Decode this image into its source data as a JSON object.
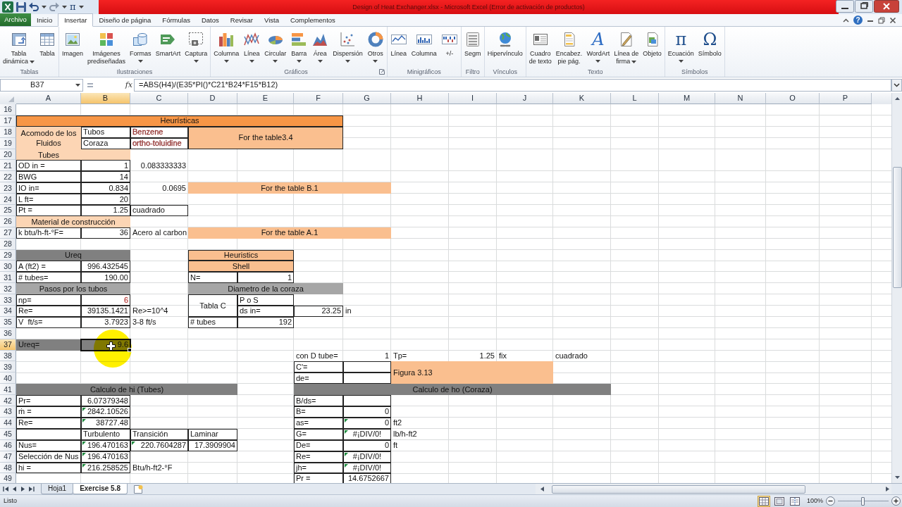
{
  "title_bar": {
    "quick_glyph": "π",
    "title": "Design of Heat Exchanger.xlsx - Microsoft Excel (Error de activación de productos)"
  },
  "ribbon_tabs": [
    {
      "label": "Archivo",
      "kind": "file",
      "selected": false
    },
    {
      "label": "Inicio",
      "kind": "tab",
      "selected": false
    },
    {
      "label": "Insertar",
      "kind": "tab",
      "selected": true
    },
    {
      "label": "Diseño de página",
      "kind": "tab",
      "selected": false
    },
    {
      "label": "Fórmulas",
      "kind": "tab",
      "selected": false
    },
    {
      "label": "Datos",
      "kind": "tab",
      "selected": false
    },
    {
      "label": "Revisar",
      "kind": "tab",
      "selected": false
    },
    {
      "label": "Vista",
      "kind": "tab",
      "selected": false
    },
    {
      "label": "Complementos",
      "kind": "tab",
      "selected": false
    }
  ],
  "help_glyph": "?",
  "ribbon_groups": [
    {
      "title": "Tablas",
      "launcher": false,
      "items": [
        {
          "label": "Tabla\ndinámica",
          "dropdown": true
        },
        {
          "label": "Tabla",
          "dropdown": false
        }
      ]
    },
    {
      "title": "Ilustraciones",
      "launcher": false,
      "items": [
        {
          "label": "Imagen",
          "dropdown": false
        },
        {
          "label": "Imágenes\nprediseñadas",
          "dropdown": false
        },
        {
          "label": "Formas",
          "dropdown": true
        },
        {
          "label": "SmartArt",
          "dropdown": false
        },
        {
          "label": "Captura",
          "dropdown": true
        }
      ]
    },
    {
      "title": "Gráficos",
      "launcher": true,
      "items": [
        {
          "label": "Columna",
          "dropdown": true
        },
        {
          "label": "Línea",
          "dropdown": true
        },
        {
          "label": "Circular",
          "dropdown": true
        },
        {
          "label": "Barra",
          "dropdown": true
        },
        {
          "label": "Área",
          "dropdown": true
        },
        {
          "label": "Dispersión",
          "dropdown": true
        },
        {
          "label": "Otros",
          "dropdown": true
        }
      ]
    },
    {
      "title": "Minigráficos",
      "launcher": false,
      "items": [
        {
          "label": "Línea",
          "dropdown": false
        },
        {
          "label": "Columna",
          "dropdown": false
        },
        {
          "label": "+/-",
          "dropdown": false
        }
      ]
    },
    {
      "title": "Filtro",
      "launcher": false,
      "items": [
        {
          "label": "Segm",
          "dropdown": false
        }
      ]
    },
    {
      "title": "Vínculos",
      "launcher": false,
      "items": [
        {
          "label": "Hipervínculo",
          "dropdown": false
        }
      ]
    },
    {
      "title": "Texto",
      "launcher": false,
      "items": [
        {
          "label": "Cuadro\nde texto",
          "dropdown": false
        },
        {
          "label": "Encabez.\npie pág.",
          "dropdown": false
        },
        {
          "label": "WordArt",
          "glyph": "A",
          "dropdown": true
        },
        {
          "label": "Línea de\nfirma",
          "dropdown": true
        },
        {
          "label": "Objeto",
          "dropdown": false
        }
      ]
    },
    {
      "title": "Símbolos",
      "launcher": false,
      "items": [
        {
          "label": "Ecuación",
          "glyph": "π",
          "dropdown": true
        },
        {
          "label": "Símbolo",
          "glyph": "Ω",
          "dropdown": false
        }
      ]
    }
  ],
  "formula_bar": {
    "name_box": "B37",
    "function_label": "fx",
    "formula": "=ABS(H4)/(E35*PI()*C21*B24*F15*B12)"
  },
  "sheet": {
    "columns": [
      {
        "label": "A",
        "selected": false
      },
      {
        "label": "B",
        "selected": true
      },
      {
        "label": "C",
        "selected": false
      },
      {
        "label": "D",
        "selected": false
      },
      {
        "label": "E",
        "selected": false
      },
      {
        "label": "F",
        "selected": false
      },
      {
        "label": "G",
        "selected": false
      },
      {
        "label": "H",
        "selected": false
      },
      {
        "label": "I",
        "selected": false
      },
      {
        "label": "J",
        "selected": false
      },
      {
        "label": "K",
        "selected": false
      },
      {
        "label": "L",
        "selected": false
      },
      {
        "label": "M",
        "selected": false
      },
      {
        "label": "N",
        "selected": false
      },
      {
        "label": "O",
        "selected": false
      },
      {
        "label": "P",
        "selected": false
      }
    ],
    "rows": [
      {
        "label": "16",
        "selected": false
      },
      {
        "label": "17",
        "selected": false,
        "cells": [
          {
            "text": "Heurísticas",
            "kind": "title",
            "boxed": true,
            "flagged": false,
            "selected": false
          }
        ]
      },
      {
        "label": "18",
        "selected": false,
        "cells": [
          {
            "text": "Acomodo de los Fluidos",
            "kind": "tint",
            "boxed": false,
            "flagged": false,
            "selected": false
          },
          {
            "text": "Tubos",
            "kind": "text",
            "boxed": true,
            "flagged": false,
            "selected": false
          },
          {
            "text": "Benzene",
            "kind": "text",
            "color": "#953735",
            "boxed": true,
            "flagged": false,
            "selected": false
          },
          {
            "text": "For the table3.4",
            "kind": "band",
            "boxed": true,
            "flagged": false,
            "selected": false
          }
        ]
      },
      {
        "label": "19",
        "selected": false,
        "cells": [
          null,
          {
            "text": "Coraza",
            "kind": "text",
            "boxed": true,
            "flagged": false,
            "selected": false
          },
          {
            "text": "ortho-toluidine",
            "kind": "text",
            "color": "#953735",
            "boxed": true,
            "flagged": false,
            "selected": false
          }
        ]
      },
      {
        "label": "20",
        "selected": false,
        "cells": [
          {
            "text": "Tubes",
            "kind": "tint",
            "boxed": false,
            "flagged": false,
            "selected": false
          },
          {
            "kind": "tint",
            "boxed": false,
            "flagged": false,
            "selected": false
          }
        ]
      },
      {
        "label": "21",
        "selected": false,
        "cells": [
          {
            "text": "OD in =",
            "kind": "text",
            "boxed": true,
            "flagged": false,
            "selected": false
          },
          {
            "text": "1",
            "kind": "number",
            "boxed": true,
            "flagged": false,
            "selected": false
          },
          {
            "text": "0.083333333",
            "kind": "number",
            "boxed": false,
            "flagged": false,
            "selected": false
          }
        ]
      },
      {
        "label": "22",
        "selected": false,
        "cells": [
          {
            "text": "BWG",
            "kind": "text",
            "boxed": true,
            "flagged": false,
            "selected": false
          },
          {
            "text": "14",
            "kind": "number",
            "boxed": true,
            "flagged": false,
            "selected": false
          }
        ]
      },
      {
        "label": "23",
        "selected": false,
        "cells": [
          {
            "text": "IO in=",
            "kind": "text",
            "boxed": true,
            "flagged": false,
            "selected": false
          },
          {
            "text": "0.834",
            "kind": "number",
            "boxed": true,
            "flagged": false,
            "selected": false
          },
          {
            "text": "0.0695",
            "kind": "number",
            "boxed": false,
            "flagged": false,
            "selected": false
          },
          {
            "text": "For the table B.1",
            "kind": "band",
            "boxed": false,
            "flagged": false,
            "selected": false
          }
        ]
      },
      {
        "label": "24",
        "selected": false,
        "cells": [
          {
            "text": "L ft=",
            "kind": "text",
            "boxed": true,
            "flagged": false,
            "selected": false
          },
          {
            "text": "20",
            "kind": "number",
            "boxed": true,
            "flagged": false,
            "selected": false
          }
        ]
      },
      {
        "label": "25",
        "selected": false,
        "cells": [
          {
            "text": "Pt =",
            "kind": "text",
            "boxed": true,
            "flagged": false,
            "selected": false
          },
          {
            "text": "1.25",
            "kind": "number",
            "boxed": true,
            "flagged": false,
            "selected": false
          },
          {
            "text": "cuadrado",
            "kind": "text",
            "boxed": true,
            "flagged": false,
            "selected": false
          }
        ]
      },
      {
        "label": "26",
        "selected": false,
        "cells": [
          {
            "text": "Material de construcción",
            "kind": "tint",
            "boxed": false,
            "flagged": false,
            "selected": false
          }
        ]
      },
      {
        "label": "27",
        "selected": false,
        "cells": [
          {
            "text": "k btu/h-ft-°F=",
            "kind": "text",
            "boxed": true,
            "flagged": false,
            "selected": false
          },
          {
            "text": "36",
            "kind": "number",
            "boxed": true,
            "flagged": false,
            "selected": false
          },
          {
            "text": "Acero al carbon",
            "kind": "text",
            "boxed": false,
            "flagged": false,
            "selected": false
          },
          {
            "text": "For the table A.1",
            "kind": "band",
            "boxed": false,
            "flagged": false,
            "selected": false
          }
        ]
      },
      {
        "label": "28",
        "selected": false
      },
      {
        "label": "29",
        "selected": false,
        "cells": [
          {
            "text": "Ureq",
            "kind": "section",
            "boxed": false,
            "flagged": false,
            "selected": false
          },
          null,
          null,
          {
            "text": "Heuristics",
            "kind": "band",
            "boxed": true,
            "flagged": false,
            "selected": false
          }
        ]
      },
      {
        "label": "30",
        "selected": false,
        "cells": [
          {
            "text": "A (ft2) =",
            "kind": "text",
            "boxed": true,
            "flagged": false,
            "selected": false
          },
          {
            "text": "996.432545",
            "kind": "number",
            "boxed": true,
            "flagged": false,
            "selected": false
          },
          null,
          {
            "text": "Shell",
            "kind": "band",
            "boxed": true,
            "flagged": false,
            "selected": false
          }
        ]
      },
      {
        "label": "31",
        "selected": false,
        "cells": [
          {
            "text": "# tubes=",
            "kind": "text",
            "boxed": true,
            "flagged": false,
            "selected": false
          },
          {
            "text": "190.00",
            "kind": "number",
            "boxed": true,
            "flagged": false,
            "selected": false
          },
          null,
          {
            "text": "N=",
            "kind": "text",
            "boxed": true,
            "flagged": false,
            "selected": false
          },
          {
            "text": "1",
            "kind": "number",
            "boxed": true,
            "flagged": false,
            "selected": false
          }
        ]
      },
      {
        "label": "32",
        "selected": false,
        "cells": [
          {
            "text": "Pasos por los tubos",
            "kind": "subsection",
            "boxed": false,
            "flagged": false,
            "selected": false
          },
          null,
          null,
          {
            "text": "Diametro de la coraza",
            "kind": "subsection",
            "boxed": false,
            "flagged": false,
            "selected": false
          }
        ]
      },
      {
        "label": "33",
        "selected": false,
        "cells": [
          {
            "text": "np=",
            "kind": "text",
            "boxed": true,
            "flagged": false,
            "selected": false
          },
          {
            "text": "6",
            "kind": "number",
            "color": "#c0504d",
            "boxed": true,
            "flagged": false,
            "selected": false
          },
          null,
          {
            "text": "Tabla C",
            "kind": "center",
            "boxed": true,
            "flagged": false,
            "selected": false
          },
          {
            "text": "P o S",
            "kind": "text",
            "boxed": true,
            "flagged": false,
            "selected": false
          }
        ]
      },
      {
        "label": "34",
        "selected": false,
        "cells": [
          {
            "text": "Re=",
            "kind": "text",
            "boxed": true,
            "flagged": false,
            "selected": false
          },
          {
            "text": "39135.1421",
            "kind": "number",
            "boxed": true,
            "flagged": false,
            "selected": false
          },
          {
            "text": "Re>=10^4",
            "kind": "text",
            "boxed": false,
            "flagged": false,
            "selected": false
          },
          null,
          {
            "text": "ds in=",
            "kind": "text",
            "boxed": true,
            "flagged": false,
            "selected": false
          },
          {
            "text": "23.25",
            "kind": "number",
            "boxed": true,
            "flagged": false,
            "selected": false
          },
          {
            "text": "in",
            "kind": "text",
            "boxed": false,
            "flagged": false,
            "selected": false
          }
        ]
      },
      {
        "label": "35",
        "selected": false,
        "cells": [
          {
            "text": "V  ft/s=",
            "kind": "text",
            "boxed": true,
            "flagged": false,
            "selected": false
          },
          {
            "text": "3.7923",
            "kind": "number",
            "boxed": true,
            "flagged": false,
            "selected": false
          },
          {
            "text": "3-8 ft/s",
            "kind": "text",
            "boxed": false,
            "flagged": false,
            "selected": false
          },
          {
            "text": "# tubes",
            "kind": "text",
            "boxed": true,
            "flagged": false,
            "selected": false
          },
          {
            "text": "192",
            "kind": "number",
            "boxed": true,
            "flagged": false,
            "selected": false
          }
        ]
      },
      {
        "label": "36",
        "selected": false
      },
      {
        "label": "37",
        "selected": true,
        "cells": [
          {
            "text": "Ureq=",
            "kind": "section-text",
            "boxed": false,
            "flagged": false,
            "selected": false
          },
          {
            "text": "9.6",
            "kind": "section-number",
            "boxed": false,
            "flagged": false,
            "selected": true
          }
        ]
      },
      {
        "label": "38",
        "selected": false,
        "cells": [
          null,
          null,
          null,
          null,
          null,
          {
            "text": "con D tube=",
            "kind": "text",
            "boxed": false,
            "flagged": false,
            "selected": false
          },
          {
            "text": "1",
            "kind": "number",
            "boxed": false,
            "flagged": false,
            "selected": false
          },
          {
            "text": "Tp=",
            "kind": "text",
            "boxed": false,
            "flagged": false,
            "selected": false
          },
          {
            "text": "1.25",
            "kind": "number",
            "boxed": false,
            "flagged": false,
            "selected": false
          },
          {
            "text": "fix",
            "kind": "text",
            "boxed": false,
            "flagged": false,
            "selected": false
          },
          {
            "text": "cuadrado",
            "kind": "text",
            "boxed": false,
            "flagged": false,
            "selected": false
          }
        ]
      },
      {
        "label": "39",
        "selected": false,
        "cells": [
          null,
          null,
          null,
          null,
          null,
          {
            "text": "C'=",
            "kind": "text",
            "boxed": true,
            "flagged": false,
            "selected": false
          },
          {
            "kind": "text",
            "boxed": true,
            "flagged": false,
            "selected": false
          },
          {
            "text": "Figura 3.13",
            "kind": "band-left",
            "boxed": false,
            "flagged": false,
            "selected": false
          }
        ]
      },
      {
        "label": "40",
        "selected": false,
        "cells": [
          null,
          null,
          null,
          null,
          null,
          {
            "text": "de=",
            "kind": "text",
            "boxed": true,
            "flagged": false,
            "selected": false
          },
          {
            "kind": "text",
            "boxed": true,
            "flagged": false,
            "selected": false
          }
        ]
      },
      {
        "label": "41",
        "selected": false,
        "cells": [
          {
            "text": "Calculo de hi (Tubes)",
            "kind": "section",
            "boxed": false,
            "flagged": false,
            "selected": false
          },
          null,
          null,
          null,
          null,
          {
            "text": "Calculo de ho (Coraza)",
            "kind": "section",
            "boxed": false,
            "flagged": false,
            "selected": false
          }
        ]
      },
      {
        "label": "42",
        "selected": false,
        "cells": [
          {
            "text": "Pr=",
            "kind": "text",
            "boxed": true,
            "flagged": false,
            "selected": false
          },
          {
            "text": "6.07379348",
            "kind": "number",
            "boxed": true,
            "flagged": false,
            "selected": false
          },
          null,
          null,
          null,
          {
            "text": "B/ds=",
            "kind": "text",
            "boxed": true,
            "flagged": false,
            "selected": false
          },
          {
            "kind": "text",
            "boxed": true,
            "flagged": false,
            "selected": false
          }
        ]
      },
      {
        "label": "43",
        "selected": false,
        "cells": [
          {
            "text": "ṁ =",
            "kind": "text",
            "boxed": true,
            "flagged": false,
            "selected": false
          },
          {
            "text": "2842.10526",
            "kind": "number",
            "boxed": true,
            "flagged": true,
            "selected": false
          },
          null,
          null,
          null,
          {
            "text": "B=",
            "kind": "text",
            "boxed": true,
            "flagged": false,
            "selected": false
          },
          {
            "text": "0",
            "kind": "number",
            "boxed": true,
            "flagged": false,
            "selected": false
          }
        ]
      },
      {
        "label": "44",
        "selected": false,
        "cells": [
          {
            "text": "Re=",
            "kind": "text",
            "boxed": true,
            "flagged": false,
            "selected": false
          },
          {
            "text": "38727.48",
            "kind": "number",
            "boxed": true,
            "flagged": true,
            "selected": false
          },
          null,
          null,
          null,
          {
            "text": "as=",
            "kind": "text",
            "boxed": true,
            "flagged": false,
            "selected": false
          },
          {
            "text": "0",
            "kind": "number",
            "boxed": true,
            "flagged": true,
            "selected": false
          },
          {
            "text": "ft2",
            "kind": "text",
            "boxed": false,
            "flagged": false,
            "selected": false
          }
        ]
      },
      {
        "label": "45",
        "selected": false,
        "cells": [
          {
            "kind": "text",
            "boxed": true,
            "flagged": false,
            "selected": false
          },
          {
            "text": "Turbulento",
            "kind": "text",
            "boxed": true,
            "flagged": false,
            "selected": false
          },
          {
            "text": "Transición",
            "kind": "text",
            "boxed": true,
            "flagged": false,
            "selected": false
          },
          {
            "text": "Laminar",
            "kind": "text",
            "boxed": true,
            "flagged": false,
            "selected": false
          },
          null,
          {
            "text": "G=",
            "kind": "text",
            "boxed": true,
            "flagged": false,
            "selected": false
          },
          {
            "text": "#¡DIV/0!",
            "kind": "center",
            "boxed": true,
            "flagged": true,
            "selected": false
          },
          {
            "text": "lb/h-ft2",
            "kind": "text",
            "boxed": false,
            "flagged": false,
            "selected": false
          }
        ]
      },
      {
        "label": "46",
        "selected": false,
        "cells": [
          {
            "text": "Nus=",
            "kind": "text",
            "boxed": true,
            "flagged": false,
            "selected": false
          },
          {
            "text": "196.470163",
            "kind": "number",
            "boxed": true,
            "flagged": true,
            "selected": false
          },
          {
            "text": "220.7604287",
            "kind": "number",
            "boxed": true,
            "flagged": true,
            "selected": false
          },
          {
            "text": "17.3909904",
            "kind": "number",
            "boxed": true,
            "flagged": false,
            "selected": false
          },
          null,
          {
            "text": "De=",
            "kind": "text",
            "boxed": true,
            "flagged": false,
            "selected": false
          },
          {
            "text": "0",
            "kind": "number",
            "boxed": true,
            "flagged": false,
            "selected": false
          },
          {
            "text": "ft",
            "kind": "text",
            "boxed": false,
            "flagged": false,
            "selected": false
          }
        ]
      },
      {
        "label": "47",
        "selected": false,
        "cells": [
          {
            "text": "Selección de Nus",
            "kind": "text",
            "boxed": true,
            "flagged": false,
            "selected": false
          },
          {
            "text": "196.470163",
            "kind": "number",
            "boxed": true,
            "flagged": true,
            "selected": false
          },
          null,
          null,
          null,
          {
            "text": "Re=",
            "kind": "text",
            "boxed": true,
            "flagged": false,
            "selected": false
          },
          {
            "text": "#¡DIV/0!",
            "kind": "center",
            "boxed": true,
            "flagged": true,
            "selected": false
          }
        ]
      },
      {
        "label": "48",
        "selected": false,
        "cells": [
          {
            "text": "hi =",
            "kind": "text",
            "boxed": true,
            "flagged": false,
            "selected": false
          },
          {
            "text": "216.258525",
            "kind": "number",
            "boxed": true,
            "flagged": true,
            "selected": false
          },
          {
            "text": "Btu/h-ft2-°F",
            "kind": "text",
            "boxed": false,
            "flagged": false,
            "selected": false
          },
          null,
          null,
          {
            "text": "jh=",
            "kind": "text",
            "boxed": true,
            "flagged": false,
            "selected": false
          },
          {
            "text": "#¡DIV/0!",
            "kind": "center",
            "boxed": true,
            "flagged": true,
            "selected": false
          }
        ]
      },
      {
        "label": "49",
        "selected": false,
        "cells": [
          null,
          null,
          null,
          null,
          null,
          {
            "text": "Pr =",
            "kind": "text",
            "boxed": true,
            "flagged": false,
            "selected": false
          },
          {
            "text": "14.6752667",
            "kind": "number",
            "boxed": true,
            "flagged": false,
            "selected": false
          }
        ]
      }
    ]
  },
  "sheet_tabs": [
    {
      "label": "Hoja1",
      "selected": false
    },
    {
      "label": "Exercise 5.8",
      "selected": true
    }
  ],
  "status_bar": {
    "text": "Listo",
    "views": [
      {
        "selected": true
      },
      {
        "selected": false
      },
      {
        "selected": false
      }
    ],
    "zoom": {
      "label": "100%",
      "level": 0.5
    }
  }
}
